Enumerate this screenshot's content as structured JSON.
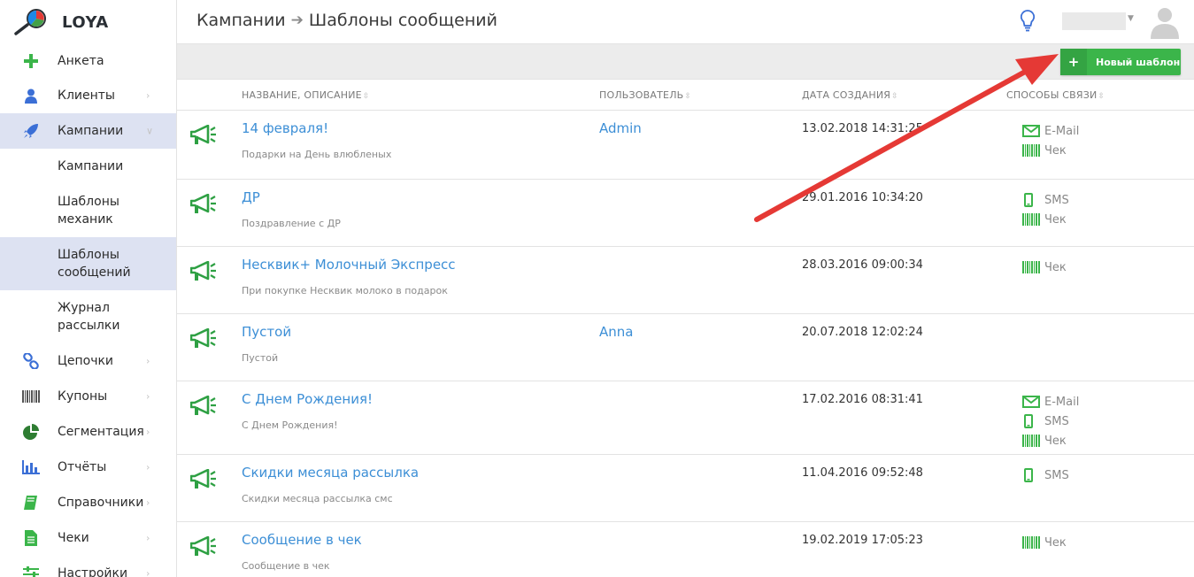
{
  "app": {
    "logo_text": "LOYA"
  },
  "sidebar": {
    "items": [
      {
        "label": "Анкета",
        "icon": "plus-icon"
      },
      {
        "label": "Клиенты",
        "icon": "user-icon"
      },
      {
        "label": "Кампании",
        "icon": "rocket-icon",
        "active": true,
        "subitems": [
          "Кампании",
          "Шаблоны механик",
          "Шаблоны сообщений",
          "Журнал рассылки"
        ]
      },
      {
        "label": "Цепочки",
        "icon": "chain-icon"
      },
      {
        "label": "Купоны",
        "icon": "barcode-icon"
      },
      {
        "label": "Сегментация",
        "icon": "pie-chart-icon"
      },
      {
        "label": "Отчёты",
        "icon": "bar-chart-icon"
      },
      {
        "label": "Справочники",
        "icon": "book-icon"
      },
      {
        "label": "Чеки",
        "icon": "document-icon"
      },
      {
        "label": "Настройки",
        "icon": "sliders-icon"
      }
    ],
    "subitems": {
      "s0_line1": "Кампании",
      "s1_line1": "Шаблоны",
      "s1_line2": "механик",
      "s2_line1": "Шаблоны",
      "s2_line2": "сообщений",
      "s3_line1": "Журнал",
      "s3_line2": "рассылки"
    }
  },
  "header": {
    "breadcrumb_parent": "Кампании",
    "breadcrumb_current": "Шаблоны сообщений"
  },
  "toolbar": {
    "new_template_label": "Новый шаблон"
  },
  "table": {
    "columns": [
      "НАЗВАНИЕ, ОПИСАНИЕ",
      "ПОЛЬЗОВАТЕЛЬ",
      "ДАТА СОЗДАНИЯ",
      "СПОСОБЫ СВЯЗИ"
    ],
    "rows": [
      {
        "name": "14 февраля!",
        "desc": "Подарки на День влюбленых",
        "user": "Admin",
        "date": "13.02.2018 14:31:25",
        "channels": [
          "E-Mail",
          "Чек"
        ]
      },
      {
        "name": "ДР",
        "desc": "Поздравление с ДР",
        "user": "",
        "date": "29.01.2016 10:34:20",
        "channels": [
          "SMS",
          "Чек"
        ]
      },
      {
        "name": "Несквик+ Молочный Экспресс",
        "desc": "При покупке Несквик молоко в подарок",
        "user": "",
        "date": "28.03.2016 09:00:34",
        "channels": [
          "Чек"
        ]
      },
      {
        "name": "Пустой",
        "desc": "Пустой",
        "user": "Anna",
        "date": "20.07.2018 12:02:24",
        "channels": []
      },
      {
        "name": "С Днем Рождения!",
        "desc": "С Днем Рождения!",
        "user": "",
        "date": "17.02.2016 08:31:41",
        "channels": [
          "E-Mail",
          "SMS",
          "Чек"
        ]
      },
      {
        "name": "Скидки месяца рассылка",
        "desc": "Скидки месяца рассылка смс",
        "user": "",
        "date": "11.04.2016 09:52:48",
        "channels": [
          "SMS"
        ]
      },
      {
        "name": "Сообщение в чек",
        "desc": "Сообщение в чек",
        "user": "",
        "date": "19.02.2019 17:05:23",
        "channels": [
          "Чек"
        ]
      }
    ]
  },
  "colors": {
    "green": "#3bb54a",
    "link": "#3d8fd6",
    "active_bg": "#dde2f2",
    "annotation_arrow": "#e53935"
  }
}
